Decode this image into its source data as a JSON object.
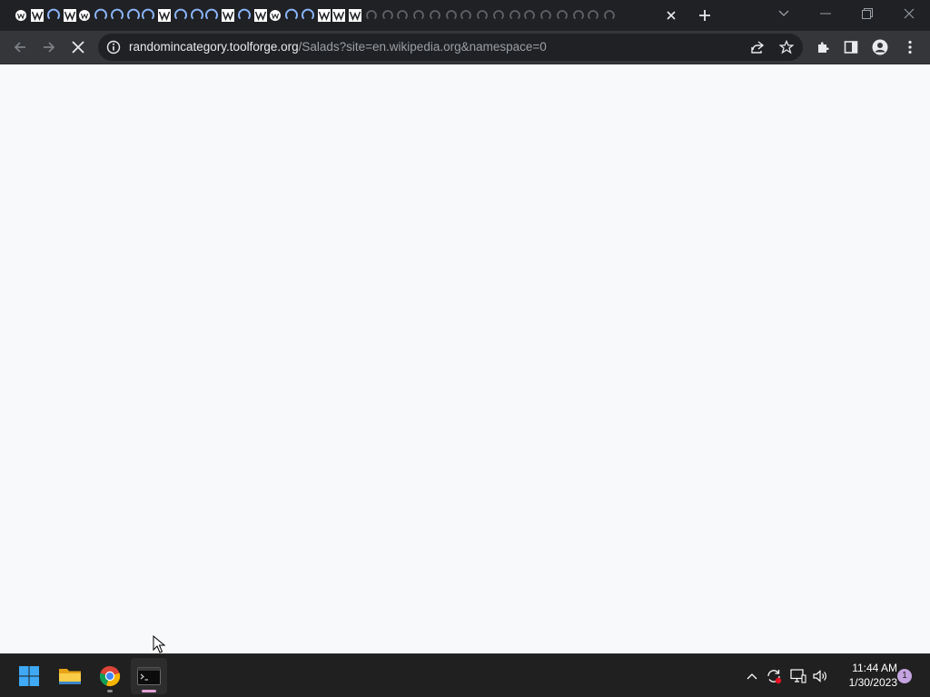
{
  "browser": {
    "tab_favicons": [
      "dot-icon",
      "wikipedia-icon",
      "loading-arc-icon",
      "wikipedia-icon",
      "dot-icon",
      "loading-arc-icon",
      "loading-arc-icon",
      "loading-arc-icon",
      "loading-arc-icon",
      "wikipedia-icon",
      "loading-arc-icon",
      "loading-arc-icon",
      "loading-arc-icon",
      "wikipedia-icon",
      "loading-arc-icon",
      "wikipedia-icon",
      "dot-icon",
      "loading-arc-icon",
      "loading-arc-icon",
      "wikipedia-icon",
      "wikipedia-icon",
      "wikipedia-icon",
      "dimmed-icon",
      "dimmed-icon",
      "dimmed-icon",
      "dimmed-icon",
      "dimmed-icon",
      "dimmed-icon",
      "dimmed-icon",
      "dimmed-icon",
      "dimmed-icon",
      "dimmed-icon",
      "dimmed-icon",
      "dimmed-icon",
      "dimmed-icon",
      "dimmed-icon",
      "dimmed-icon",
      "dimmed-icon"
    ],
    "address": {
      "host": "randomincategory.toolforge.org",
      "path": "/Salads?site=en.wikipedia.org&namespace=0"
    },
    "page_loading": true
  },
  "taskbar": {
    "apps": [
      {
        "name": "start",
        "icon": "windows-logo-icon",
        "active": false
      },
      {
        "name": "file-explorer",
        "icon": "folder-icon",
        "active": false
      },
      {
        "name": "chrome",
        "icon": "chrome-icon",
        "active": false
      },
      {
        "name": "terminal",
        "icon": "terminal-icon",
        "active": true
      }
    ],
    "clock": {
      "time": "11:44 AM",
      "date": "1/30/2023"
    },
    "notification_count": "1"
  },
  "colors": {
    "titlebar": "#202124",
    "toolbar": "#35363a",
    "page_background": "#f8f9fa",
    "taskbar": "#202020",
    "accent_blue": "#8ab4f8",
    "notification": "#c4a4e0"
  }
}
